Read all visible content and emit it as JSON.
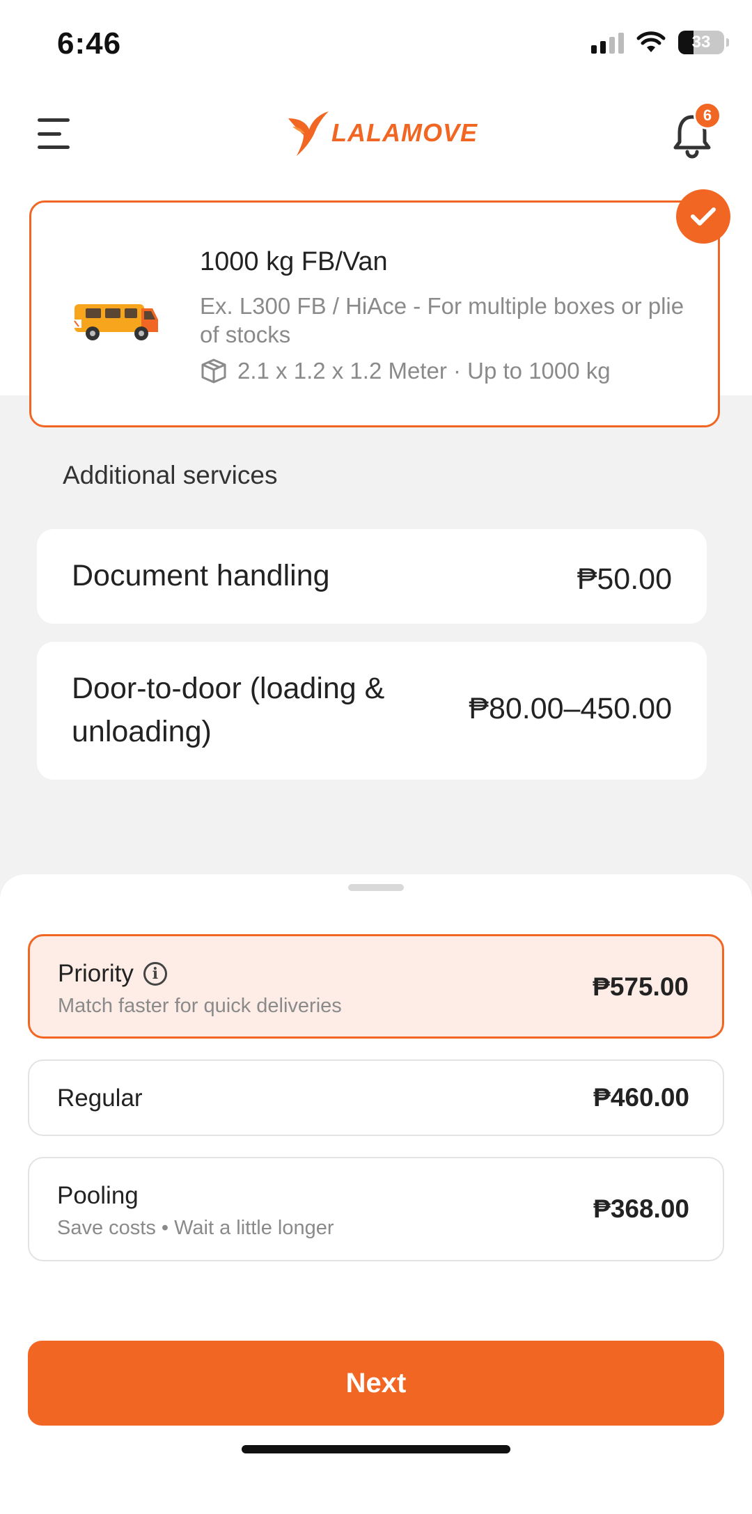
{
  "status_bar": {
    "time": "6:46",
    "battery": "33"
  },
  "header": {
    "logo_text": "LALAMOVE",
    "notification_count": "6",
    "accent_color": "#f16622"
  },
  "vehicle": {
    "title": "1000 kg FB/Van",
    "description": "Ex. L300 FB / HiAce - For multiple boxes or plie of stocks",
    "spec": "2.1 x 1.2 x 1.2 Meter · Up to 1000 kg",
    "selected": true
  },
  "additional_services": {
    "title": "Additional services",
    "items": [
      {
        "name": "Document handling",
        "price": "₱50.00"
      },
      {
        "name": "Door-to-door (loading & unloading)",
        "price": "₱80.00–450.00"
      }
    ]
  },
  "delivery_options": [
    {
      "name": "Priority",
      "subtitle": "Match faster for quick deliveries",
      "price": "₱575.00",
      "selected": true
    },
    {
      "name": "Regular",
      "subtitle": "",
      "price": "₱460.00",
      "selected": false
    },
    {
      "name": "Pooling",
      "subtitle": "Save costs • Wait a little longer",
      "price": "₱368.00",
      "selected": false
    }
  ],
  "next_button": {
    "label": "Next"
  }
}
